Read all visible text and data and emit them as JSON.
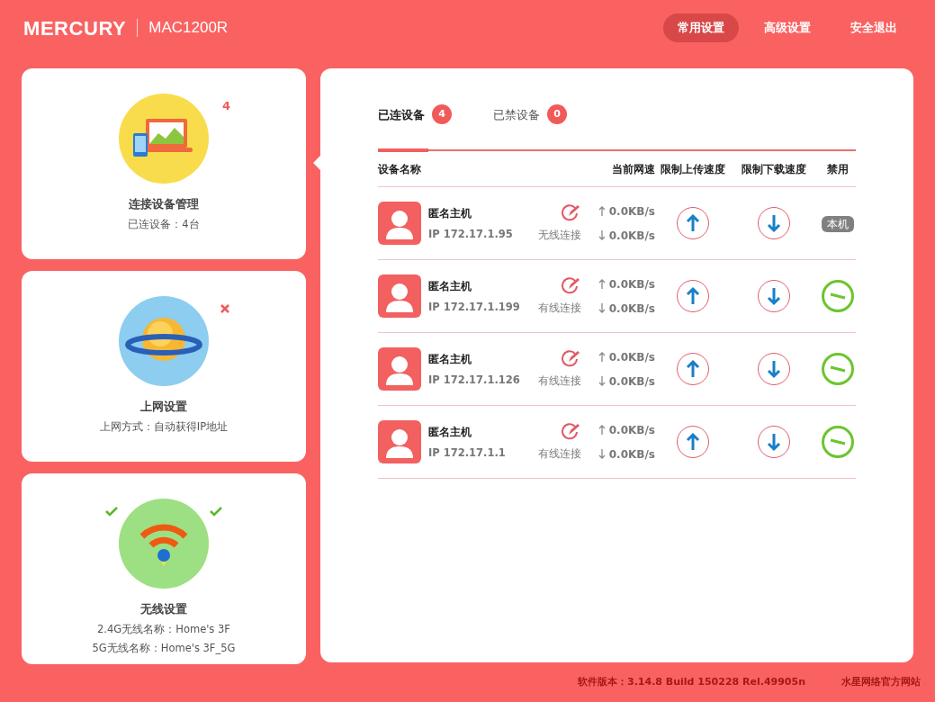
{
  "header": {
    "brand": "MERCURY",
    "model": "MAC1200R",
    "nav": [
      {
        "label": "常用设置",
        "selected": true
      },
      {
        "label": "高级设置",
        "selected": false
      },
      {
        "label": "安全退出",
        "selected": false
      }
    ]
  },
  "cards": [
    {
      "kind": "devices",
      "title": "连接设备管理",
      "lines": [
        "已连设备：4台"
      ],
      "badge": "4",
      "selected": true
    },
    {
      "kind": "internet",
      "title": "上网设置",
      "lines": [
        "上网方式：自动获得IP地址"
      ],
      "selected": false
    },
    {
      "kind": "wireless",
      "title": "无线设置",
      "lines": [
        "2.4G无线名称：Home's 3F",
        "5G无线名称：Home's 3F_5G"
      ],
      "selected": false
    }
  ],
  "tabs": [
    {
      "label": "已连设备",
      "count": "4",
      "selected": true
    },
    {
      "label": "已禁设备",
      "count": "0",
      "selected": false
    }
  ],
  "table": {
    "columns": [
      "设备名称",
      "当前网速",
      "限制上传速度",
      "限制下载速度",
      "禁用"
    ],
    "rows": [
      {
        "name": "匿名主机",
        "ip": "IP 172.17.1.95",
        "connection": "无线连接",
        "up": "0.0KB/s",
        "down": "0.0KB/s",
        "disable": {
          "kind": "badge",
          "label": "本机"
        }
      },
      {
        "name": "匿名主机",
        "ip": "IP 172.17.1.199",
        "connection": "有线连接",
        "up": "0.0KB/s",
        "down": "0.0KB/s",
        "disable": {
          "kind": "toggle"
        }
      },
      {
        "name": "匿名主机",
        "ip": "IP 172.17.1.126",
        "connection": "有线连接",
        "up": "0.0KB/s",
        "down": "0.0KB/s",
        "disable": {
          "kind": "toggle"
        }
      },
      {
        "name": "匿名主机",
        "ip": "IP 172.17.1.1",
        "connection": "有线连接",
        "up": "0.0KB/s",
        "down": "0.0KB/s",
        "disable": {
          "kind": "toggle"
        }
      }
    ]
  },
  "footer": {
    "version": "软件版本：3.14.8 Build 150228 Rel.49905n",
    "link": "水星网络官方网站"
  }
}
